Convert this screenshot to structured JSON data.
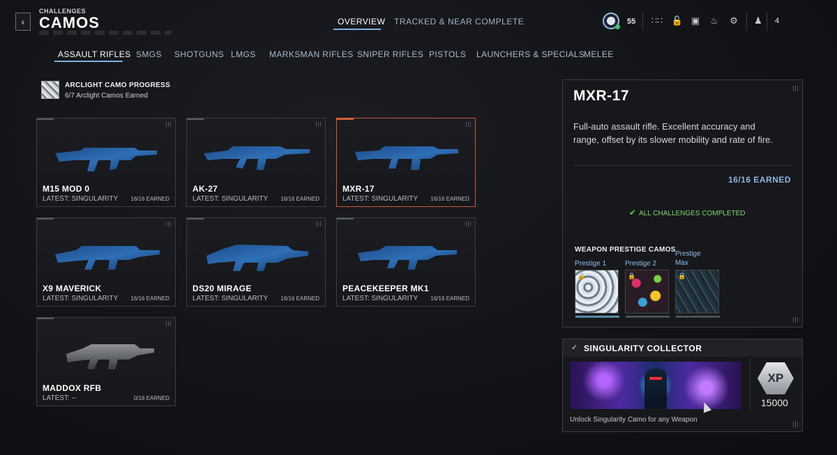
{
  "header": {
    "breadcrumb": "CHALLENGES",
    "title": "CAMOS",
    "tabs": [
      {
        "label": "OVERVIEW",
        "active": true
      },
      {
        "label": "TRACKED & NEAR COMPLETE",
        "active": false
      }
    ],
    "rank": "55",
    "party_count": "4",
    "icons": [
      "grid-icon",
      "unlock-icon",
      "camera-icon",
      "bell-icon",
      "gear-icon",
      "party-icon"
    ]
  },
  "categories": [
    "ASSAULT RIFLES",
    "SMGS",
    "SHOTGUNS",
    "LMGS",
    "MARKSMAN RIFLES",
    "SNIPER RIFLES",
    "PISTOLS",
    "LAUNCHERS & SPECIALS",
    "MELEE"
  ],
  "arclight": {
    "title": "ARCLIGHT CAMO PROGRESS",
    "progress": "6/7 Arclight Camos Earned"
  },
  "weapons": [
    {
      "name": "M15 MOD 0",
      "latest": "LATEST: SINGULARITY",
      "earned": "16/16 EARNED"
    },
    {
      "name": "AK-27",
      "latest": "LATEST: SINGULARITY",
      "earned": "16/16 EARNED"
    },
    {
      "name": "MXR-17",
      "latest": "LATEST: SINGULARITY",
      "earned": "16/16 EARNED"
    },
    {
      "name": "X9 MAVERICK",
      "latest": "LATEST: SINGULARITY",
      "earned": "16/16 EARNED"
    },
    {
      "name": "DS20 MIRAGE",
      "latest": "LATEST: SINGULARITY",
      "earned": "16/16 EARNED"
    },
    {
      "name": "PEACEKEEPER MK1",
      "latest": "LATEST: SINGULARITY",
      "earned": "16/16 EARNED"
    },
    {
      "name": "MADDOX RFB",
      "latest": "LATEST: --",
      "earned": "0/16 EARNED"
    }
  ],
  "detail": {
    "name": "MXR-17",
    "description": "Full-auto assault rifle. Excellent accuracy and range, offset by its slower mobility and rate of fire.",
    "earned": "16/16 EARNED",
    "status": "ALL CHALLENGES COMPLETED",
    "prestige_heading": "WEAPON PRESTIGE CAMOS",
    "prestige": [
      {
        "label": "Prestige 1"
      },
      {
        "label": "Prestige 2"
      },
      {
        "label": "Prestige",
        "label2": "Max"
      }
    ]
  },
  "collector": {
    "title": "SINGULARITY COLLECTOR",
    "xp_badge": "XP",
    "xp": "15000",
    "description": "Unlock Singularity Camo for any Weapon"
  }
}
